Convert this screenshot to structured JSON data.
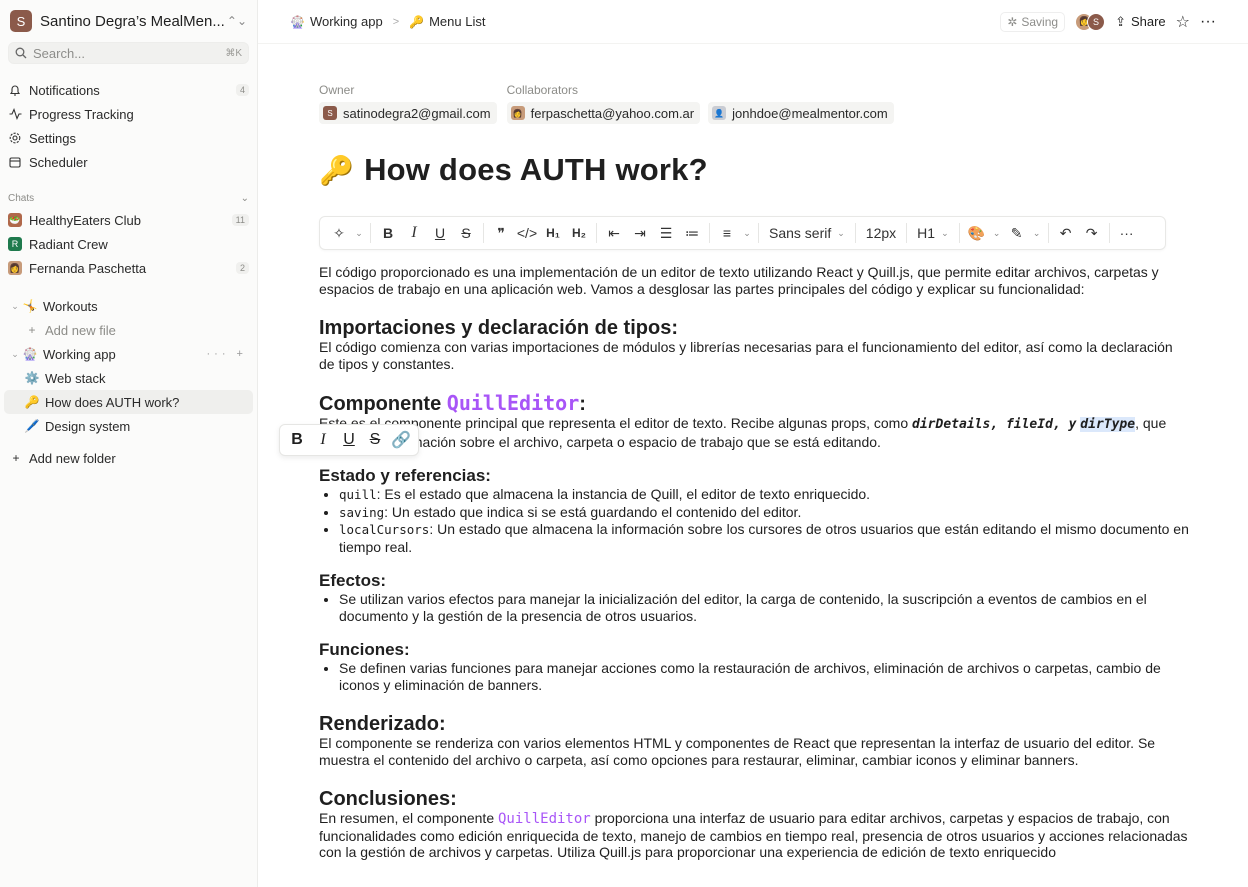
{
  "workspace": {
    "initial": "S",
    "name": "Santino Degra’s MealMen..."
  },
  "search": {
    "placeholder": "Search...",
    "shortcut": "⌘K"
  },
  "nav": [
    {
      "label": "Notifications",
      "icon": "bell-icon",
      "badge": "4"
    },
    {
      "label": "Progress Tracking",
      "icon": "activity-icon",
      "badge": ""
    },
    {
      "label": "Settings",
      "icon": "gear-icon",
      "badge": ""
    },
    {
      "label": "Scheduler",
      "icon": "calendar-icon",
      "badge": ""
    }
  ],
  "chats": {
    "title": "Chats",
    "items": [
      {
        "label": "HealthyEaters Club",
        "badge": "11",
        "initial": "",
        "color": "#b0684a"
      },
      {
        "label": "Radiant Crew",
        "badge": "",
        "initial": "R",
        "color": "#1f7a4d"
      },
      {
        "label": "Fernanda Paschetta",
        "badge": "2",
        "initial": "",
        "color": "#c79b7a"
      }
    ]
  },
  "tree": {
    "workouts": {
      "label": "Workouts",
      "emoji": "🤸"
    },
    "add_file": "Add new file",
    "working_app": {
      "label": "Working app",
      "emoji": "🎡"
    },
    "files": [
      {
        "label": "Web stack",
        "emoji": "⚙️"
      },
      {
        "label": "How does AUTH work?",
        "emoji": "🔑"
      },
      {
        "label": "Design system",
        "emoji": "🖊️"
      }
    ],
    "add_folder": "Add new folder"
  },
  "breadcrumb": [
    {
      "label": "Working app",
      "emoji": "🎡"
    },
    {
      "label": "Menu List",
      "emoji": "🔑"
    }
  ],
  "topbar": {
    "saving": "Saving",
    "share": "Share",
    "avatar_initial": "S"
  },
  "meta": {
    "owner_label": "Owner",
    "owner": "satinodegra2@gmail.com",
    "owner_initial": "S",
    "collab_label": "Collaborators",
    "collaborators": [
      "ferpaschetta@yahoo.com.ar",
      "jonhdoe@mealmentor.com"
    ]
  },
  "doc_title": {
    "emoji": "🔑",
    "text": "How does AUTH work?"
  },
  "toolbar": {
    "font": "Sans serif",
    "size": "12px",
    "heading": "H1"
  },
  "doc": {
    "intro": "El código proporcionado es una implementación de un editor de texto utilizando React y Quill.js, que permite editar archivos, carpetas y espacios de trabajo en una aplicación web. Vamos a desglosar las partes principales del código y explicar su funcionalidad:",
    "h_imports": "Importaciones y declaración de tipos:",
    "p_imports": "El código comienza con varias importaciones de módulos y librerías necesarias para el funcionamiento del editor, así como la declaración de tipos y constantes.",
    "h_comp_pre": "Componente ",
    "h_comp_code": "QuillEditor",
    "h_comp_post": ":",
    "p_comp_pre": "Este es el componente principal que representa el editor de texto. Recibe algunas props, como ",
    "p_comp_code1": "dirDetails, fileId, y",
    "p_comp_code2": "dirType",
    "p_comp_post": ", que contienen información sobre el archivo, carpeta o espacio de trabajo que se está editando.",
    "h_state": "Estado y referencias:",
    "state_items": [
      {
        "code": "quill",
        "text": ": Es el estado que almacena la instancia de Quill, el editor de texto enriquecido."
      },
      {
        "code": "saving",
        "text": ": Un estado que indica si se está guardando el contenido del editor."
      },
      {
        "code": "localCursors",
        "text": ": Un estado que almacena la información sobre los cursores de otros usuarios que están editando el mismo documento en tiempo real."
      }
    ],
    "h_effects": "Efectos:",
    "effects_item": "Se utilizan varios efectos para manejar la inicialización del editor, la carga de contenido, la suscripción a eventos de cambios en el documento y la gestión de la presencia de otros usuarios.",
    "h_functions": "Funciones:",
    "functions_item": "Se definen varias funciones para manejar acciones como la restauración de archivos, eliminación de archivos o carpetas, cambio de iconos y eliminación de banners.",
    "h_render": "Renderizado:",
    "p_render": "El componente se renderiza con varios elementos HTML y componentes de React que representan la interfaz de usuario del editor. Se muestra el contenido del archivo o carpeta, así como opciones para restaurar, eliminar, cambiar iconos y eliminar banners.",
    "h_concl": "Conclusiones:",
    "p_concl_pre": "En resumen, el componente ",
    "p_concl_code": "QuillEditor",
    "p_concl_post": " proporciona una interfaz de usuario para editar archivos, carpetas y espacios de trabajo, con funcionalidades como edición enriquecida de texto, manejo de cambios en tiempo real, presencia de otros usuarios y acciones relacionadas con la gestión de archivos y carpetas. Utiliza Quill.js para proporcionar una experiencia de edición de texto enriquecido"
  },
  "colors": {
    "accent": "#a855f7",
    "selection": "#dbe8fb"
  }
}
